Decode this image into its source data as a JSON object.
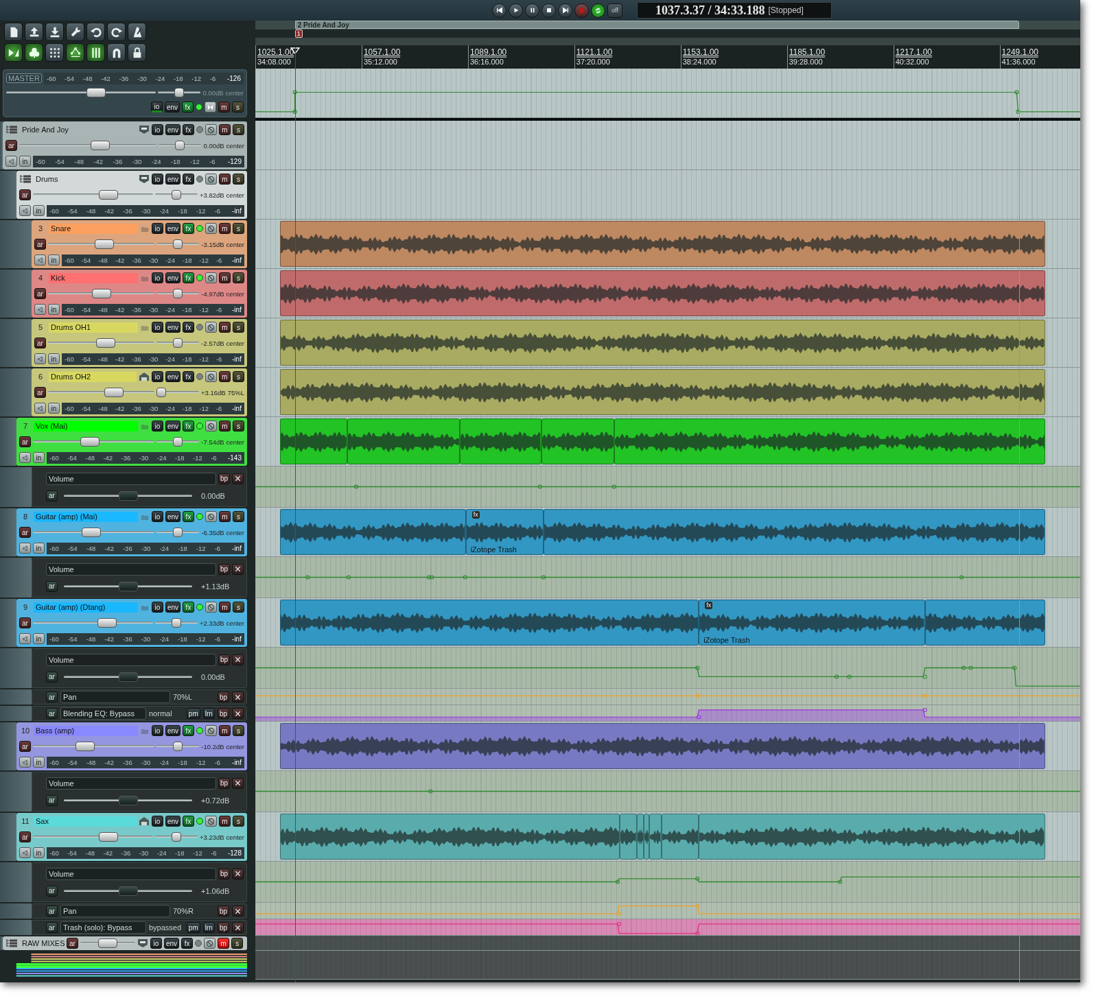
{
  "transport": {
    "repeat_on": true,
    "off_label": "off",
    "position": "1037.3.37 / 34:33.188",
    "state": "[Stopped]"
  },
  "toolbar": [
    {
      "on": false
    },
    {
      "on": false
    },
    {
      "on": false
    },
    {
      "on": false
    },
    {
      "on": false
    },
    {
      "on": false
    },
    {
      "on": false
    },
    {
      "on": true
    },
    {
      "on": true
    },
    {
      "on": false
    },
    {
      "on": true
    },
    {
      "on": true
    },
    {
      "on": false
    },
    {
      "on": false
    }
  ],
  "regions": [
    {
      "label": "2 Pride And Joy"
    }
  ],
  "markers": [
    {
      "number": "1"
    }
  ],
  "ruler": [
    {
      "bar": "1025.1.00",
      "time": "34:08.000"
    },
    {
      "bar": "1057.1.00",
      "time": "35:12.000"
    },
    {
      "bar": "1089.1.00",
      "time": "36:16.000"
    },
    {
      "bar": "1121.1.00",
      "time": "37:20.000"
    },
    {
      "bar": "1153.1.00",
      "time": "38:24.000"
    },
    {
      "bar": "1185.1.00",
      "time": "39:28.000"
    },
    {
      "bar": "1217.1.00",
      "time": "40:32.000"
    },
    {
      "bar": "1249.1.00",
      "time": "41:36.000"
    }
  ],
  "master": {
    "label": "MASTER",
    "scale": [
      "-60",
      "-54",
      "-48",
      "-42",
      "-36",
      "-30",
      "-24",
      "-18",
      "-12",
      "-6"
    ],
    "peak": "-126",
    "volume": "0.00dB",
    "pan": "center",
    "volume_fader": {
      "level": 0.6
    },
    "pan_fader": {
      "level": 0.5
    },
    "fx_active": true,
    "muted": false,
    "labels": {
      "io": "io",
      "env": "env",
      "fx": "fx",
      "mute": "m",
      "solo": "s"
    }
  },
  "tracks": [
    {
      "kind": "track",
      "name": "Pride And Joy",
      "is_folder": true,
      "fx_active": false,
      "muted": false,
      "volume": "0.00dB",
      "pan": "center",
      "peak": "-129",
      "volume_fader": {
        "level": 0.59
      },
      "pan_fader": {
        "level": 0.5
      },
      "scale": [
        "-60",
        "-54",
        "-48",
        "-42",
        "-36",
        "-30",
        "-24",
        "-18",
        "-12",
        "-6"
      ],
      "labels": {
        "io": "io",
        "env": "env",
        "fx": "fx",
        "mute": "m",
        "solo": "s",
        "arm": "ar",
        "input": "in"
      },
      "children": [
        {
          "kind": "track",
          "name": "Drums",
          "is_folder": true,
          "fx_active": false,
          "muted": false,
          "volume": "+3.82dB",
          "pan": "center",
          "peak": "-inf",
          "volume_fader": {
            "level": 0.63
          },
          "pan_fader": {
            "level": 0.5
          },
          "scale": [
            "-60",
            "-54",
            "-48",
            "-42",
            "-36",
            "-30",
            "-24",
            "-18",
            "-12",
            "-6"
          ],
          "labels": {
            "io": "io",
            "env": "env",
            "fx": "fx",
            "mute": "m",
            "solo": "s",
            "arm": "ar",
            "input": "in"
          },
          "children": [
            {
              "kind": "track",
              "number": "3",
              "name": "Snare",
              "color": "#fca060",
              "is_folder": false,
              "folder_end": false,
              "fx_active": true,
              "muted": false,
              "volume": "-3.15dB",
              "pan": "center",
              "peak": "-inf",
              "volume_fader": {
                "level": 0.53
              },
              "pan_fader": {
                "level": 0.5
              },
              "scale": [
                "-60",
                "-54",
                "-48",
                "-42",
                "-36",
                "-30",
                "-24",
                "-18",
                "-12",
                "-6"
              ],
              "labels": {
                "io": "io",
                "env": "env",
                "fx": "fx",
                "mute": "m",
                "solo": "s",
                "arm": "ar",
                "input": "in"
              },
              "items": [
                {
                  "kind": "audio"
                }
              ]
            },
            {
              "kind": "track",
              "number": "4",
              "name": "Kick",
              "color": "#ff7070",
              "is_folder": false,
              "folder_end": false,
              "fx_active": true,
              "muted": false,
              "volume": "-4.97dB",
              "pan": "center",
              "peak": "-inf",
              "volume_fader": {
                "level": 0.5
              },
              "pan_fader": {
                "level": 0.5
              },
              "scale": [
                "-60",
                "-54",
                "-48",
                "-42",
                "-36",
                "-30",
                "-24",
                "-18",
                "-12",
                "-6"
              ],
              "labels": {
                "io": "io",
                "env": "env",
                "fx": "fx",
                "mute": "m",
                "solo": "s",
                "arm": "ar",
                "input": "in"
              },
              "items": [
                {
                  "kind": "audio"
                }
              ]
            },
            {
              "kind": "track",
              "number": "5",
              "name": "Drums OH1",
              "color": "#d8d860",
              "is_folder": false,
              "folder_end": false,
              "fx_active": false,
              "muted": false,
              "volume": "-2.57dB",
              "pan": "center",
              "peak": "-inf",
              "volume_fader": {
                "level": 0.54
              },
              "pan_fader": {
                "level": 0.5
              },
              "scale": [
                "-60",
                "-54",
                "-48",
                "-42",
                "-36",
                "-30",
                "-24",
                "-18",
                "-12",
                "-6"
              ],
              "labels": {
                "io": "io",
                "env": "env",
                "fx": "fx",
                "mute": "m",
                "solo": "s",
                "arm": "ar",
                "input": "in"
              },
              "items": [
                {
                  "kind": "audio"
                }
              ]
            },
            {
              "kind": "track",
              "number": "6",
              "name": "Drums OH2",
              "color": "#d8d860",
              "is_folder": false,
              "folder_end": true,
              "fx_active": false,
              "muted": false,
              "volume": "+3.16dB",
              "pan": "75%L",
              "peak": "-inf",
              "volume_fader": {
                "level": 0.62
              },
              "pan_fader": {
                "level": 0.12
              },
              "scale": [
                "-60",
                "-54",
                "-48",
                "-42",
                "-36",
                "-30",
                "-24",
                "-18",
                "-12",
                "-6"
              ],
              "labels": {
                "io": "io",
                "env": "env",
                "fx": "fx",
                "mute": "m",
                "solo": "s",
                "arm": "ar",
                "input": "in"
              },
              "items": [
                {
                  "kind": "audio"
                }
              ]
            }
          ]
        },
        {
          "kind": "track",
          "number": "7",
          "name": "Vox (Mai)",
          "color": "#00ff00",
          "is_folder": false,
          "folder_end": false,
          "fx_active": true,
          "muted": false,
          "volume": "-7.54dB",
          "pan": "center",
          "peak": "-143",
          "volume_fader": {
            "level": 0.47
          },
          "pan_fader": {
            "level": 0.5
          },
          "scale": [
            "-60",
            "-54",
            "-48",
            "-42",
            "-36",
            "-30",
            "-24",
            "-18",
            "-12",
            "-6"
          ],
          "labels": {
            "io": "io",
            "env": "env",
            "fx": "fx",
            "mute": "m",
            "solo": "s",
            "arm": "ar",
            "input": "in"
          },
          "items": [
            {
              "kind": "audio"
            },
            {
              "kind": "audio"
            },
            {
              "kind": "audio"
            },
            {
              "kind": "audio"
            },
            {
              "kind": "audio"
            }
          ],
          "envelopes": [
            {
              "kind": "volume",
              "name": "Volume",
              "value": "0.00dB",
              "fader": {
                "level": 0.5
              },
              "labels": {
                "arm": "ar",
                "bypass": "bp"
              }
            }
          ]
        },
        {
          "kind": "track",
          "number": "8",
          "name": "Guitar (amp) (Mai)",
          "color": "#1ab8ff",
          "is_folder": false,
          "folder_end": false,
          "fx_active": true,
          "muted": false,
          "volume": "-6.35dB",
          "pan": "center",
          "peak": "-inf",
          "volume_fader": {
            "level": 0.48
          },
          "pan_fader": {
            "level": 0.5
          },
          "scale": [
            "-60",
            "-54",
            "-48",
            "-42",
            "-36",
            "-30",
            "-24",
            "-18",
            "-12",
            "-6"
          ],
          "labels": {
            "io": "io",
            "env": "env",
            "fx": "fx",
            "mute": "m",
            "solo": "s",
            "arm": "ar",
            "input": "in"
          },
          "items": [
            {
              "kind": "audio"
            },
            {
              "kind": "audio",
              "badge": "fx",
              "take_name": "iZotope Trash"
            },
            {
              "kind": "audio"
            }
          ],
          "envelopes": [
            {
              "kind": "volume",
              "name": "Volume",
              "value": "+1.13dB",
              "fader": {
                "level": 0.5
              },
              "labels": {
                "arm": "ar",
                "bypass": "bp"
              }
            }
          ]
        },
        {
          "kind": "track",
          "number": "9",
          "name": "Guitar (amp) (Dtang)",
          "color": "#1ab8ff",
          "is_folder": false,
          "folder_end": false,
          "fx_active": true,
          "muted": false,
          "volume": "+2.33dB",
          "pan": "center",
          "peak": "-inf",
          "volume_fader": {
            "level": 0.62
          },
          "pan_fader": {
            "level": 0.5
          },
          "scale": [
            "-60",
            "-54",
            "-48",
            "-42",
            "-36",
            "-30",
            "-24",
            "-18",
            "-12",
            "-6"
          ],
          "labels": {
            "io": "io",
            "env": "env",
            "fx": "fx",
            "mute": "m",
            "solo": "s",
            "arm": "ar",
            "input": "in"
          },
          "items": [
            {
              "kind": "audio"
            },
            {
              "kind": "audio",
              "badge": "fx",
              "take_name": "iZotope Trash"
            },
            {
              "kind": "audio"
            }
          ],
          "envelopes": [
            {
              "kind": "volume",
              "name": "Volume",
              "value": "0.00dB",
              "fader": {
                "level": 0.5
              },
              "labels": {
                "arm": "ar",
                "bypass": "bp"
              }
            },
            {
              "kind": "pan",
              "name": "Pan",
              "value": "70%L",
              "labels": {
                "arm": "ar",
                "bypass": "bp"
              }
            },
            {
              "kind": "param",
              "name": "Blending EQ: Bypass",
              "value": "normal",
              "labels": {
                "arm": "ar",
                "mod": "pm",
                "learn": "lrn",
                "bypass": "bp"
              }
            }
          ]
        },
        {
          "kind": "track",
          "number": "10",
          "name": "Bass (amp)",
          "color": "#8888ff",
          "is_folder": false,
          "folder_end": false,
          "fx_active": true,
          "muted": false,
          "volume": "-10.2dB",
          "pan": "center",
          "peak": "-inf",
          "volume_fader": {
            "level": 0.43
          },
          "pan_fader": {
            "level": 0.5
          },
          "scale": [
            "-60",
            "-54",
            "-48",
            "-42",
            "-36",
            "-30",
            "-24",
            "-18",
            "-12",
            "-6"
          ],
          "labels": {
            "io": "io",
            "env": "env",
            "fx": "fx",
            "mute": "m",
            "solo": "s",
            "arm": "ar",
            "input": "in"
          },
          "items": [
            {
              "kind": "audio"
            }
          ],
          "envelopes": [
            {
              "kind": "volume",
              "name": "Volume",
              "value": "+0.72dB",
              "fader": {
                "level": 0.5
              },
              "labels": {
                "arm": "ar",
                "bypass": "bp"
              }
            }
          ]
        },
        {
          "kind": "track",
          "number": "11",
          "name": "Sax",
          "color": "#5adada",
          "is_folder": false,
          "folder_end": true,
          "fx_active": true,
          "muted": false,
          "volume": "+3.23dB",
          "pan": "center",
          "peak": "-128",
          "volume_fader": {
            "level": 0.63
          },
          "pan_fader": {
            "level": 0.5
          },
          "scale": [
            "-60",
            "-54",
            "-48",
            "-42",
            "-36",
            "-30",
            "-24",
            "-18",
            "-12",
            "-6"
          ],
          "labels": {
            "io": "io",
            "env": "env",
            "fx": "fx",
            "mute": "m",
            "solo": "s",
            "arm": "ar",
            "input": "in"
          },
          "items": [
            {
              "kind": "audio"
            },
            {
              "kind": "audio"
            },
            {
              "kind": "audio"
            },
            {
              "kind": "audio"
            },
            {
              "kind": "audio"
            },
            {
              "kind": "audio"
            },
            {
              "kind": "audio"
            }
          ],
          "envelopes": [
            {
              "kind": "volume",
              "name": "Volume",
              "value": "+1.06dB",
              "fader": {
                "level": 0.5
              },
              "labels": {
                "arm": "ar",
                "bypass": "bp"
              }
            },
            {
              "kind": "pan",
              "name": "Pan",
              "value": "70%R",
              "labels": {
                "arm": "ar",
                "bypass": "bp"
              }
            },
            {
              "kind": "param",
              "name": "Trash (solo): Bypass",
              "value": "bypassed",
              "labels": {
                "arm": "ar",
                "mod": "pm",
                "learn": "lrn",
                "bypass": "bp"
              }
            }
          ]
        }
      ]
    },
    {
      "kind": "folder_collapsed",
      "name": "RAW MIXES",
      "is_folder": true,
      "fx_active": false,
      "muted": true,
      "volume_fader": {
        "level": 0.5
      },
      "labels": {
        "io": "io",
        "env": "env",
        "fx": "fx",
        "mute": "m",
        "solo": "s",
        "arm": "ar"
      }
    }
  ]
}
